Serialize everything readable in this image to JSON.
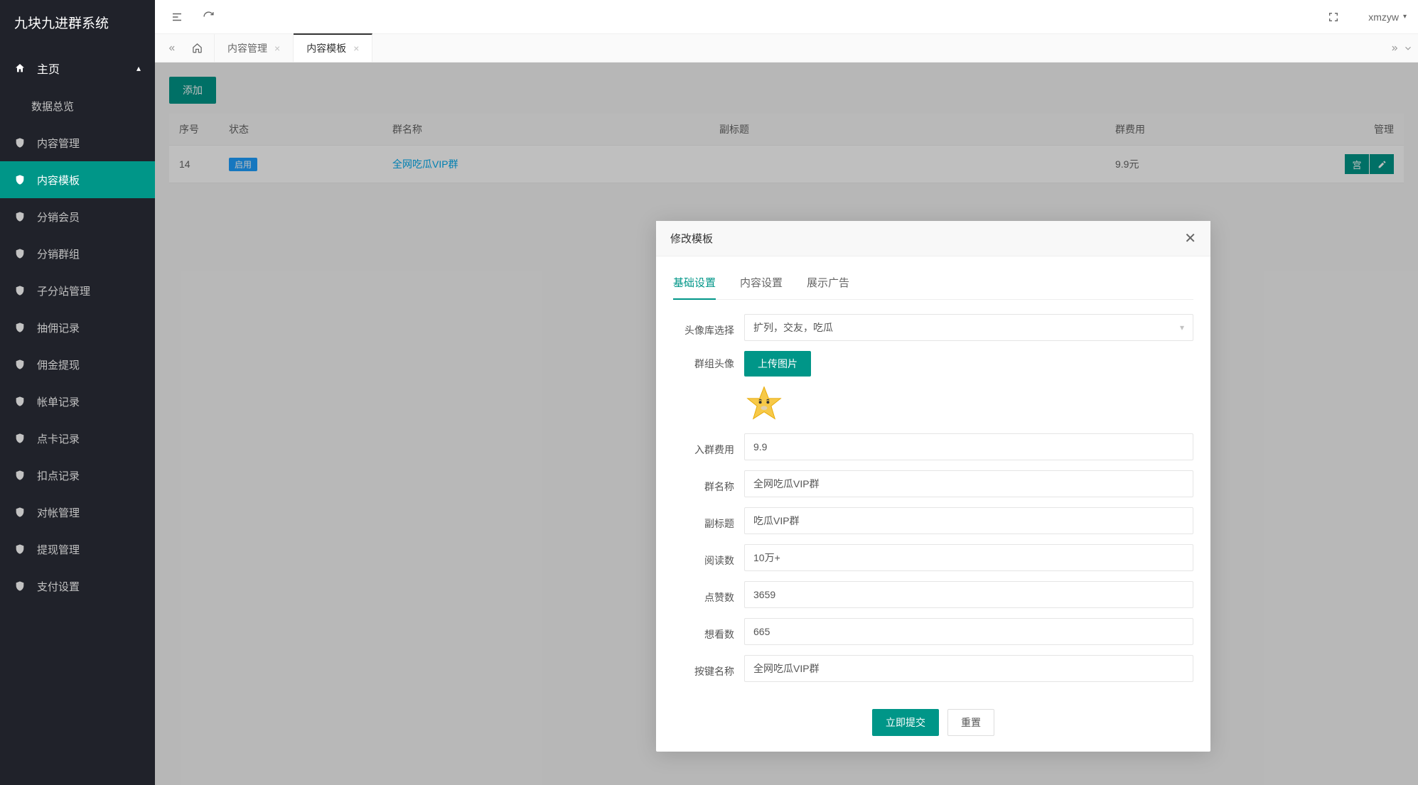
{
  "app": {
    "title": "九块九进群系统"
  },
  "sidebar": {
    "group": "主页",
    "items": [
      {
        "label": "数据总览",
        "icon": false,
        "active": false
      },
      {
        "label": "内容管理",
        "icon": true,
        "active": false
      },
      {
        "label": "内容模板",
        "icon": true,
        "active": true
      },
      {
        "label": "分销会员",
        "icon": true,
        "active": false
      },
      {
        "label": "分销群组",
        "icon": true,
        "active": false
      },
      {
        "label": "子分站管理",
        "icon": true,
        "active": false
      },
      {
        "label": "抽佣记录",
        "icon": true,
        "active": false
      },
      {
        "label": "佣金提现",
        "icon": true,
        "active": false
      },
      {
        "label": "帐单记录",
        "icon": true,
        "active": false
      },
      {
        "label": "点卡记录",
        "icon": true,
        "active": false
      },
      {
        "label": "扣点记录",
        "icon": true,
        "active": false
      },
      {
        "label": "对帐管理",
        "icon": true,
        "active": false
      },
      {
        "label": "提现管理",
        "icon": true,
        "active": false
      },
      {
        "label": "支付设置",
        "icon": true,
        "active": false
      }
    ]
  },
  "topbar": {
    "user": "xmzyw"
  },
  "tabs": [
    {
      "label": "内容管理",
      "active": false
    },
    {
      "label": "内容模板",
      "active": true
    }
  ],
  "page": {
    "add_label": "添加",
    "columns": [
      "序号",
      "状态",
      "群名称",
      "副标题",
      "群费用",
      "管理"
    ],
    "rows": [
      {
        "id": "14",
        "status": "启用",
        "name": "全网吃瓜VIP群",
        "subtitle": "",
        "fee": "9.9元",
        "op_left": "宫"
      }
    ]
  },
  "modal": {
    "title": "修改模板",
    "tabs": [
      "基础设置",
      "内容设置",
      "展示广告"
    ],
    "active_tab": 0,
    "form": {
      "avatar_lib_label": "头像库选择",
      "avatar_lib_value": "扩列，交友，吃瓜",
      "group_avatar_label": "群组头像",
      "upload_label": "上传图片",
      "join_fee_label": "入群费用",
      "join_fee_value": "9.9",
      "group_name_label": "群名称",
      "group_name_value": "全网吃瓜VIP群",
      "subtitle_label": "副标题",
      "subtitle_value": "吃瓜VIP群",
      "reads_label": "阅读数",
      "reads_value": "10万+",
      "likes_label": "点赞数",
      "likes_value": "3659",
      "wants_label": "想看数",
      "wants_value": "665",
      "button_name_label": "按键名称",
      "button_name_value": "全网吃瓜VIP群"
    },
    "submit_label": "立即提交",
    "reset_label": "重置"
  }
}
